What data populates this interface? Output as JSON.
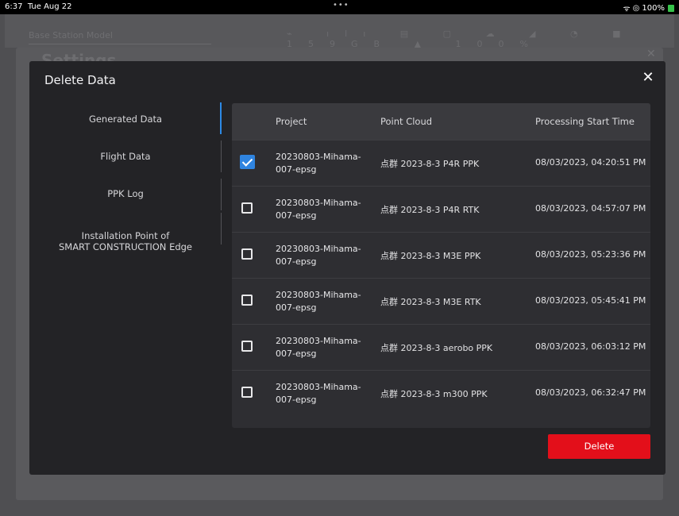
{
  "status_bar": {
    "time": "6:37",
    "date": "Tue Aug 22",
    "dots": "•••",
    "wifi": "ᯤ",
    "signal": "◎",
    "battery": "100%"
  },
  "background": {
    "toolbar_title": "Base Station Model",
    "toolbar_glyphs": "⌁ ılı ▤ ▢ ☁ ◢ ◔ ■ 159GB ▲ 100%",
    "settings_title": "Settings",
    "close": "✕"
  },
  "modal": {
    "title": "Delete Data",
    "close": "✕",
    "nav": [
      {
        "label": "Generated Data",
        "active": true
      },
      {
        "label": "Flight Data",
        "active": false
      },
      {
        "label": "PPK Log",
        "active": false
      },
      {
        "label": "Installation Point of\nSMART CONSTRUCTION Edge",
        "active": false
      }
    ],
    "table": {
      "headers": [
        "Project",
        "Point Cloud",
        "Processing Start Time"
      ],
      "rows": [
        {
          "project": "20230803-Mihama-007-epsg",
          "cloud": "点群 2023-8-3 P4R PPK",
          "time": "08/03/2023, 04:20:51 PM",
          "checked": true
        },
        {
          "project": "20230803-Mihama-007-epsg",
          "cloud": "点群 2023-8-3 P4R RTK",
          "time": "08/03/2023, 04:57:07 PM",
          "checked": false
        },
        {
          "project": "20230803-Mihama-007-epsg",
          "cloud": "点群 2023-8-3 M3E PPK",
          "time": "08/03/2023, 05:23:36 PM",
          "checked": false
        },
        {
          "project": "20230803-Mihama-007-epsg",
          "cloud": "点群 2023-8-3 M3E RTK",
          "time": "08/03/2023, 05:45:41 PM",
          "checked": false
        },
        {
          "project": "20230803-Mihama-007-epsg",
          "cloud": "点群 2023-8-3 aerobo PPK",
          "time": "08/03/2023, 06:03:12 PM",
          "checked": false
        },
        {
          "project": "20230803-Mihama-007-epsg",
          "cloud": "点群 2023-8-3 m300 PPK",
          "time": "08/03/2023, 06:32:47 PM",
          "checked": false
        }
      ]
    },
    "delete_label": "Delete"
  },
  "colors": {
    "accent": "#2f84e0",
    "danger": "#e30f1a",
    "modal_bg": "#232326",
    "table_bg": "#2e2e32"
  }
}
